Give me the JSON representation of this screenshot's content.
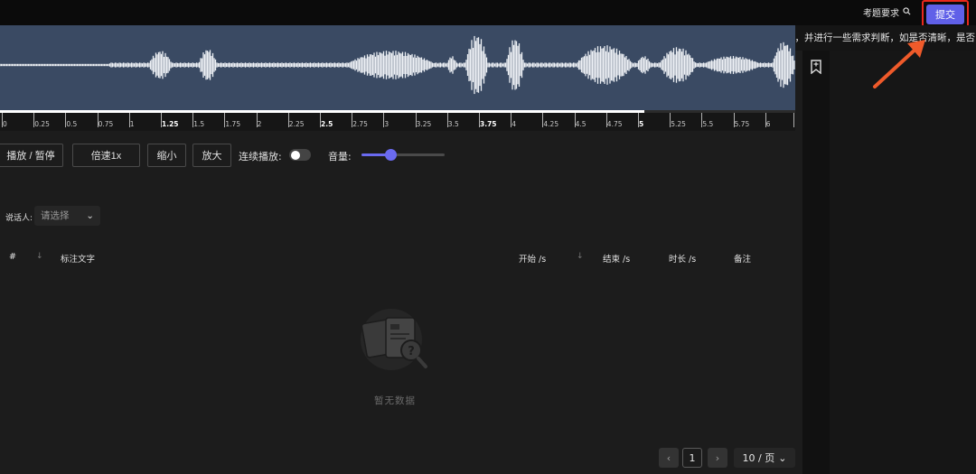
{
  "header": {
    "requirements_label": "考题要求",
    "search_icon": "search-icon",
    "submit_label": "提交",
    "tooltip": "将音频内的语音转为文字，并进行一些需求判断，如是否清晰，是否"
  },
  "timeline": {
    "ticks": [
      "0",
      "0.25",
      "0.5",
      "0.75",
      "1",
      "1.25",
      "1.5",
      "1.75",
      "2",
      "2.25",
      "2.5",
      "2.75",
      "3",
      "3.25",
      "3.5",
      "3.75",
      "4",
      "4.25",
      "4.5",
      "4.75",
      "5",
      "5.25",
      "5.5",
      "5.75",
      "6"
    ],
    "bold_ticks": [
      "1.25",
      "2.5",
      "3.75",
      "5"
    ],
    "progress_percent": 81
  },
  "controls": {
    "play_pause": "播放 / 暂停",
    "speed": "倍速1x",
    "zoom_out": "缩小",
    "zoom_in": "放大",
    "continuous_play": "连续播放:",
    "continuous_on": false,
    "volume": "音量:",
    "volume_level": 0.35
  },
  "speaker": {
    "label": "说话人:",
    "placeholder": "请选择"
  },
  "table": {
    "columns": {
      "index": "#",
      "text": "标注文字",
      "start": "开始 /s",
      "end": "结束 /s",
      "duration": "时长 /s",
      "note": "备注"
    },
    "empty_text": "暂无数据"
  },
  "pagination": {
    "current_page": "1",
    "page_size": "10 / 页",
    "prev": "‹",
    "next": "›"
  },
  "colors": {
    "accent": "#6060e8",
    "highlight": "#e8281c",
    "waveform_bg": "#3a4a63"
  }
}
